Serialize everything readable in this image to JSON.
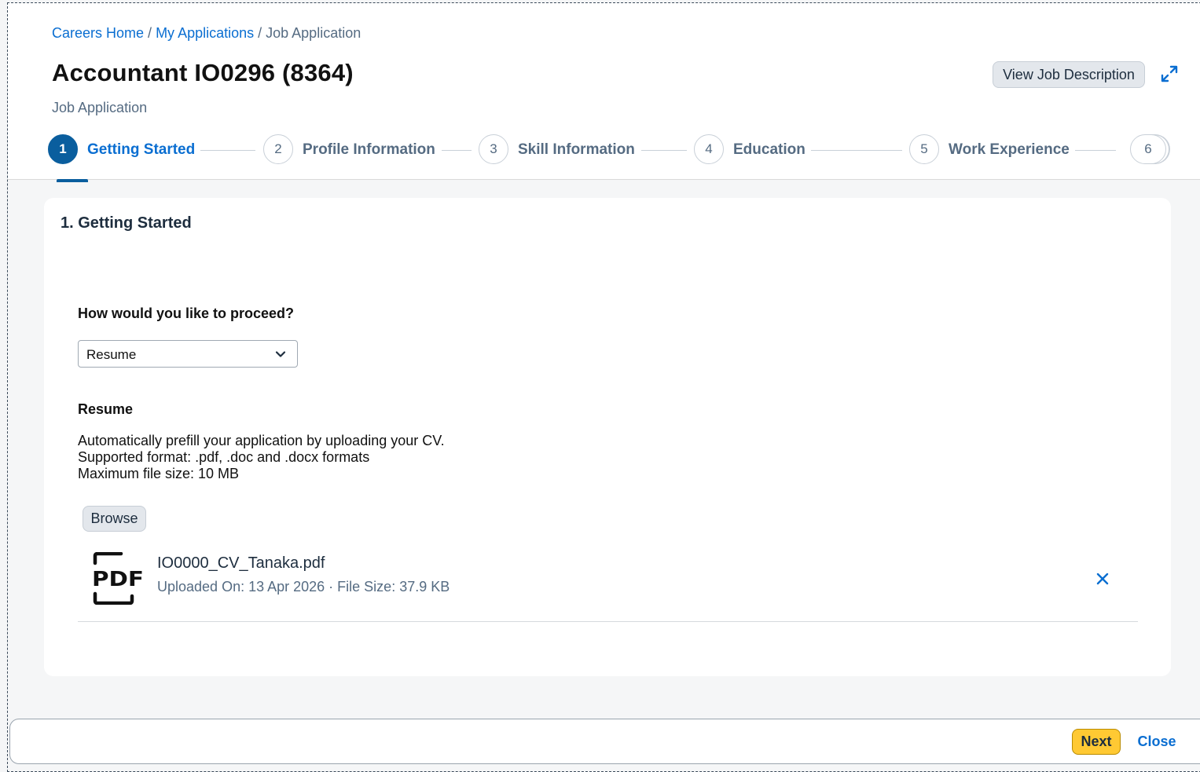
{
  "breadcrumb": {
    "items": [
      "Careers Home",
      "My Applications"
    ],
    "separator": "/",
    "current": "Job Application"
  },
  "header": {
    "title": "Accountant IO0296 (8364)",
    "subtitle": "Job Application",
    "view_job_description_label": "View Job Description",
    "expand_icon": "expand-icon"
  },
  "steps": [
    {
      "number": "1",
      "label": "Getting Started",
      "active": true
    },
    {
      "number": "2",
      "label": "Profile Information",
      "active": false
    },
    {
      "number": "3",
      "label": "Skill Information",
      "active": false
    },
    {
      "number": "4",
      "label": "Education",
      "active": false
    },
    {
      "number": "5",
      "label": "Work Experience",
      "active": false
    },
    {
      "number": "6",
      "label": "",
      "active": false
    }
  ],
  "main": {
    "section_title": "1. Getting Started",
    "question": "How would you like to proceed?",
    "proceed_select": {
      "value": "Resume"
    },
    "resume_heading": "Resume",
    "description_lines": [
      "Automatically prefill your application by uploading your CV.",
      "Supported format: .pdf, .doc and .docx formats",
      "Maximum file size: 10 MB"
    ],
    "browse_label": "Browse",
    "file": {
      "icon_text": "PDF",
      "name": "IO0000_CV_Tanaka.pdf",
      "uploaded": "Uploaded On: 13 Apr 2026",
      "separator": "·",
      "size": "File Size: 37.9 KB"
    }
  },
  "footer": {
    "next_label": "Next",
    "close_label": "Close"
  },
  "colors": {
    "accent": "#0a6ed1",
    "active_step": "#0a5e9e",
    "emphasized_button": "#ffc933"
  }
}
